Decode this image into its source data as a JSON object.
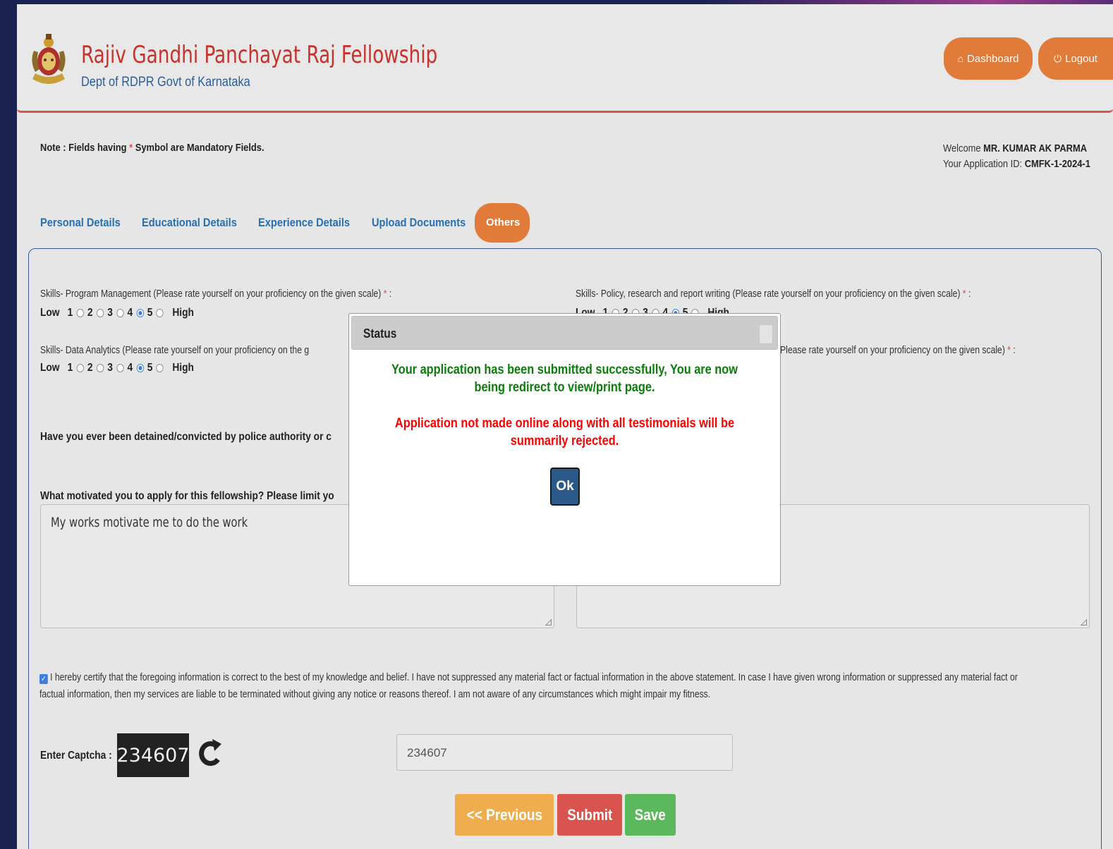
{
  "header": {
    "title": "Rajiv Gandhi Panchayat Raj Fellowship",
    "subtitle": "Dept of RDPR Govt of Karnataka",
    "dashboard_label": "Dashboard",
    "logout_label": "Logout"
  },
  "note": {
    "prefix": "Note : Fields having ",
    "star": "*",
    "suffix": " Symbol are Mandatory Fields."
  },
  "welcome": {
    "welcome_label": "Welcome ",
    "user_name": "MR. KUMAR AK PARMA",
    "app_id_label": "Your Application ID: ",
    "app_id": "CMFK-1-2024-1"
  },
  "tabs": [
    "Personal Details",
    "Educational Details",
    "Experience Details",
    "Upload Documents",
    "Others"
  ],
  "form": {
    "skills_program": "Skills- Program Management (Please rate yourself on your proficiency on the given scale)",
    "skills_policy": "Skills- Policy, research and report writing (Please rate yourself on your proficiency on the given scale)",
    "skills_data_visible": "Skills- Data Analytics (Please rate yourself on your proficiency on the g",
    "skills_right_visible": "Please rate yourself on your proficiency on the given scale)",
    "star": "*",
    "colon": " :",
    "rating_low": "Low",
    "rating_high": "High",
    "rating_program": 4,
    "rating_data": 4,
    "rating_policy": 4,
    "detained_question_visible": "Have you ever been detained/convicted by police authority or c",
    "motivation_question_visible": "What motivated you to apply for this fellowship? Please limit yo",
    "motivation_value": "My works motivate me to do the work",
    "certify_text": "I hereby certify that the foregoing information is correct to the best of my knowledge and belief. I have not suppressed any material fact or factual information in the above statement. In case I have given wrong information or suppressed any material fact or factual information, then my services are liable to be terminated without giving any notice or reasons thereof. I am not aware of any circumstances which might impair my fitness.",
    "captcha_label": "Enter Captcha :",
    "captcha_code": "234607",
    "captcha_input_value": "234607",
    "previous_label": "<< Previous",
    "submit_label": "Submit",
    "save_label": "Save"
  },
  "modal": {
    "title": "Status",
    "success_message": "Your application has been submitted successfully, You are now being redirect to view/print page.",
    "warning_message": "Application not made online along with all testimonials will be summarily rejected.",
    "ok_label": "Ok"
  },
  "colors": {
    "accent_orange": "#e07b3a",
    "header_red": "#c7322d",
    "link_blue": "#2a6fb0",
    "success_green": "#0a7d0a",
    "warning_red": "#ff0000",
    "submit_red": "#d9534f",
    "save_green": "#5cb85c",
    "previous_orange": "#f0ad4e"
  }
}
